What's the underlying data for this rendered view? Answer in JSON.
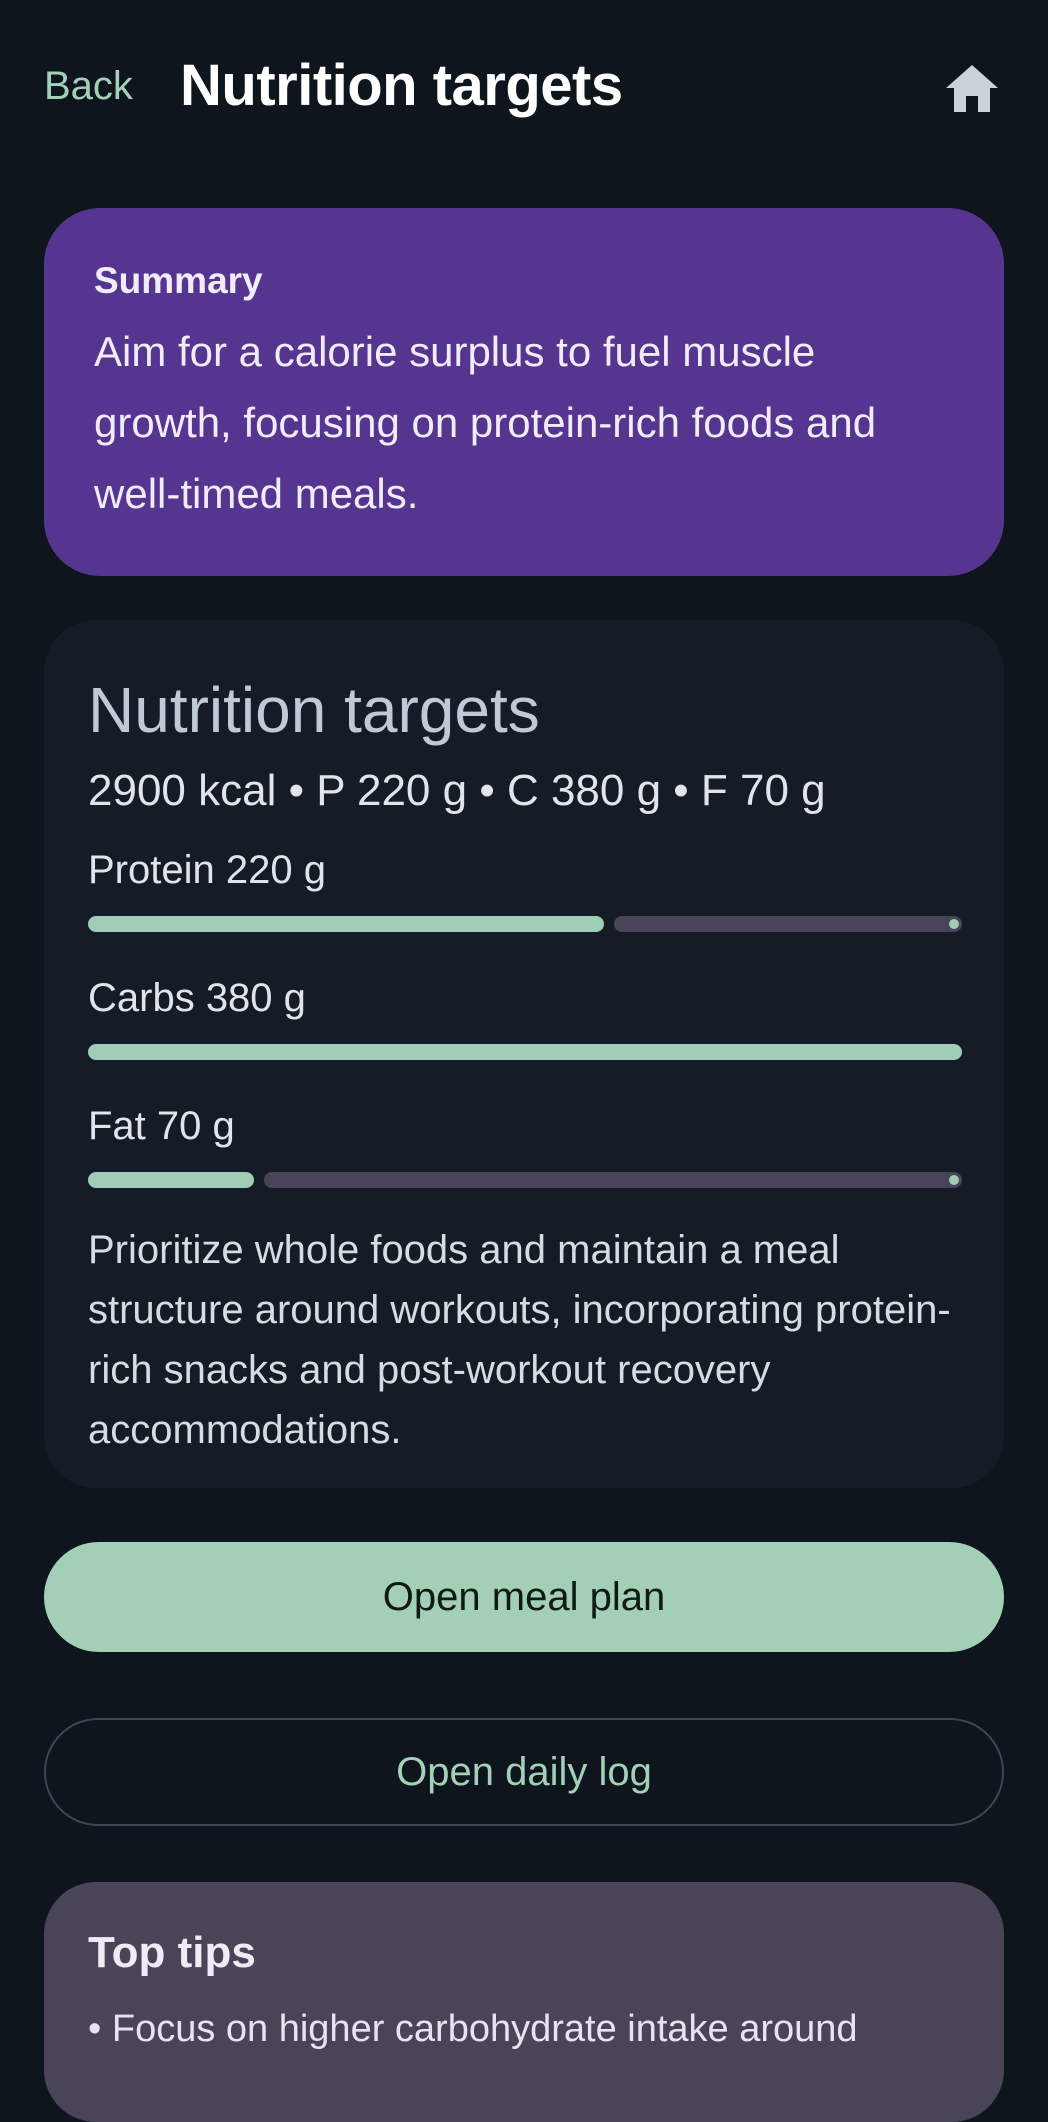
{
  "header": {
    "back_label": "Back",
    "title": "Nutrition targets",
    "home_icon": "home-icon"
  },
  "summary": {
    "label": "Summary",
    "text": "Aim for a calorie surplus to fuel muscle growth, focusing on protein-rich foods and well-timed meals."
  },
  "targets": {
    "title": "Nutrition targets",
    "line": "2900 kcal • P 220 g • C 380 g • F 70 g",
    "macros": [
      {
        "label": "Protein 220 g",
        "progress": 0.59
      },
      {
        "label": "Carbs 380 g",
        "progress": 1.0
      },
      {
        "label": "Fat 70 g",
        "progress": 0.19
      }
    ],
    "note": "Prioritize whole foods and maintain a meal structure around workouts, incorporating protein-rich snacks and post-workout recovery accommodations."
  },
  "actions": {
    "primary_label": "Open meal plan",
    "secondary_label": "Open daily log"
  },
  "tips": {
    "title": "Top tips",
    "items": [
      "• Focus on higher carbohydrate intake around"
    ]
  },
  "colors": {
    "background": "#0e151c",
    "accent": "#a3cfb7",
    "summary_card": "#55358f",
    "tips_card": "#4a4459"
  }
}
